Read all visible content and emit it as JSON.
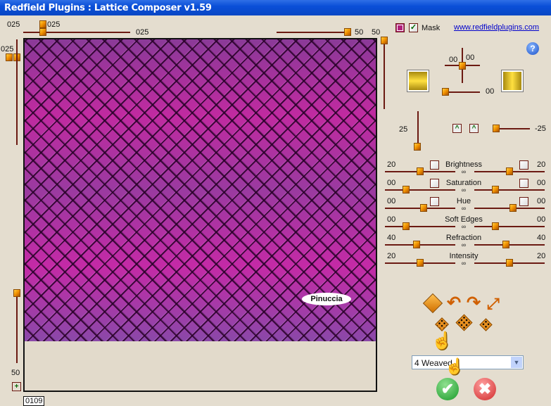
{
  "title": "Redfield Plugins : Lattice Composer v1.59",
  "top": {
    "left_label": "025",
    "thumb_label": "025",
    "hslider_value": "025",
    "right_slider_value": "50",
    "right_label": "50"
  },
  "left": {
    "top_label": "025",
    "bottom_label": "50"
  },
  "frame_counter": "0109",
  "watermark": "Pinuccia",
  "mask": {
    "label": "Mask",
    "checked": true,
    "color": "#b0207a"
  },
  "link": "www.redfieldplugins.com",
  "light": {
    "x": "00",
    "y": "00",
    "h_value": "00",
    "v_value": "25",
    "angle_value": "-25"
  },
  "effects": [
    {
      "label": "Brightness",
      "left": "20",
      "right": "20",
      "left_pos": 0.45,
      "right_pos": 0.45,
      "checkboxes": true
    },
    {
      "label": "Saturation",
      "left": "00",
      "right": "00",
      "left_pos": 0.25,
      "right_pos": 0.25,
      "checkboxes": true
    },
    {
      "label": "Hue",
      "left": "00",
      "right": "00",
      "left_pos": 0.5,
      "right_pos": 0.5,
      "checkboxes": true
    },
    {
      "label": "Soft Edges",
      "left": "00",
      "right": "00",
      "left_pos": 0.25,
      "right_pos": 0.25,
      "checkboxes": false
    },
    {
      "label": "Refraction",
      "left": "40",
      "right": "40",
      "left_pos": 0.4,
      "right_pos": 0.4,
      "checkboxes": false
    },
    {
      "label": "Intensity",
      "left": "20",
      "right": "20",
      "left_pos": 0.45,
      "right_pos": 0.45,
      "checkboxes": false
    }
  ],
  "preset": {
    "value": "4 Weaved"
  },
  "buttons": {
    "ok": "✔",
    "cancel": "✖"
  }
}
